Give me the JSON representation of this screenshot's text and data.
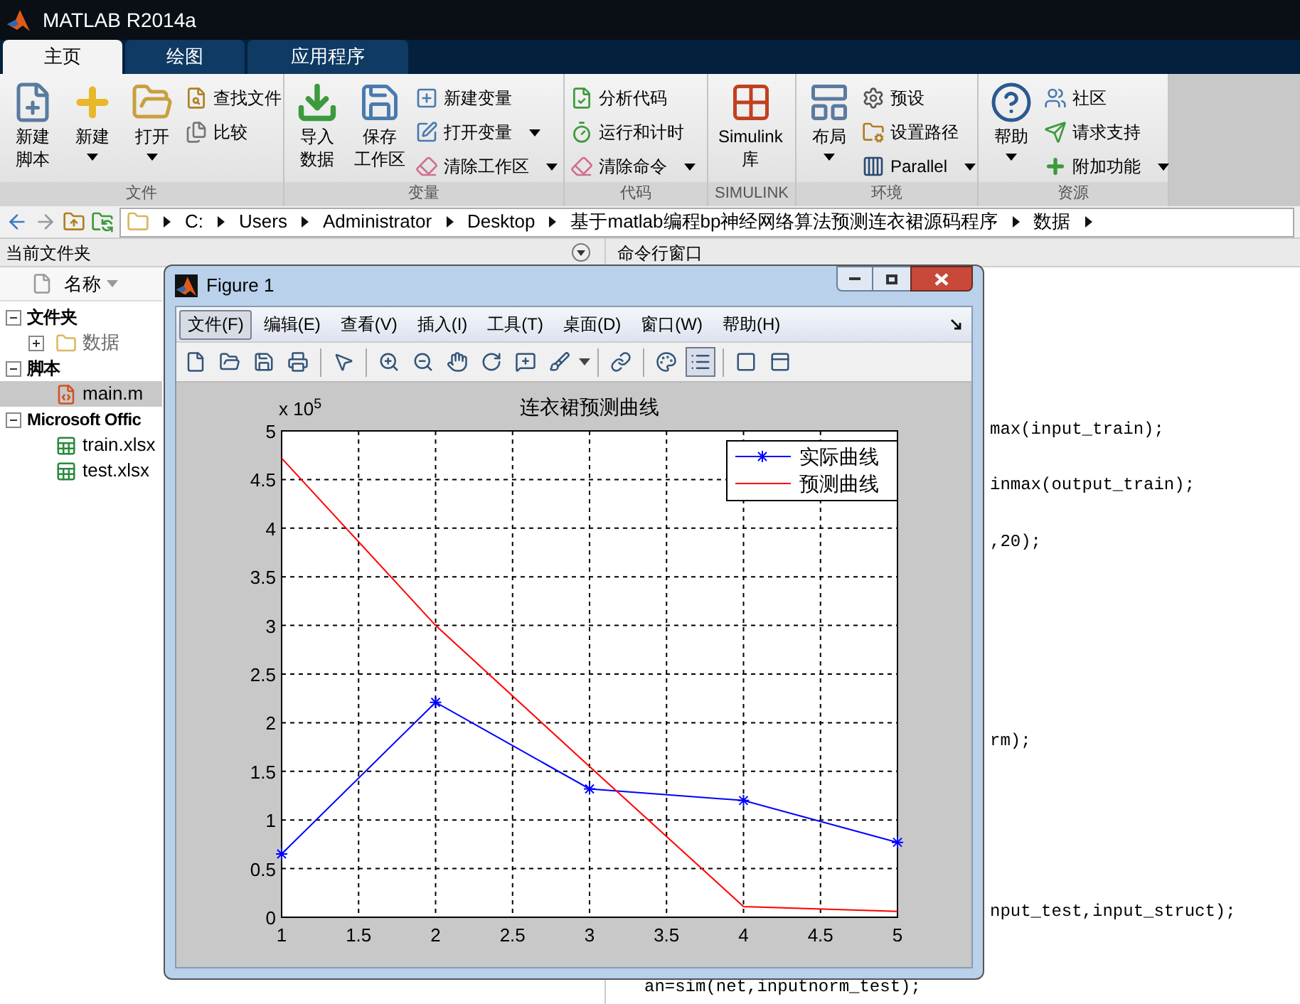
{
  "window": {
    "title": "MATLAB R2014a"
  },
  "tabs": [
    {
      "label": "主页",
      "selected": true
    },
    {
      "label": "绘图",
      "selected": false
    },
    {
      "label": "应用程序",
      "selected": false
    }
  ],
  "ribbon": {
    "groups": [
      {
        "label": "文件",
        "big": [
          {
            "lines": [
              "新建",
              "脚本"
            ],
            "has_menu": false
          },
          {
            "lines": [
              "新建"
            ],
            "has_menu": true
          },
          {
            "lines": [
              "打开"
            ],
            "has_menu": true
          }
        ],
        "small": [
          {
            "label": "查找文件",
            "has_menu": false
          },
          {
            "label": "比较",
            "has_menu": false
          }
        ]
      },
      {
        "label": "变量",
        "big": [
          {
            "lines": [
              "导入",
              "数据"
            ],
            "has_menu": false
          },
          {
            "lines": [
              "保存",
              "工作区"
            ],
            "has_menu": false
          }
        ],
        "small": [
          {
            "label": "新建变量",
            "has_menu": false
          },
          {
            "label": "打开变量",
            "has_menu": true
          },
          {
            "label": "清除工作区",
            "has_menu": true
          }
        ]
      },
      {
        "label": "代码",
        "small": [
          {
            "label": "分析代码",
            "has_menu": false
          },
          {
            "label": "运行和计时",
            "has_menu": false
          },
          {
            "label": "清除命令",
            "has_menu": true
          }
        ]
      },
      {
        "label": "SIMULINK",
        "big": [
          {
            "lines": [
              "Simulink",
              "库"
            ],
            "has_menu": false
          }
        ]
      },
      {
        "label": "环境",
        "big": [
          {
            "lines": [
              "布局"
            ],
            "has_menu": true
          }
        ],
        "small": [
          {
            "label": "预设",
            "has_menu": false
          },
          {
            "label": "设置路径",
            "has_menu": false
          },
          {
            "label": "Parallel",
            "has_menu": true
          }
        ]
      },
      {
        "label": "资源",
        "big": [
          {
            "lines": [
              "帮助"
            ],
            "has_menu": true
          }
        ],
        "small": [
          {
            "label": "社区",
            "has_menu": false
          },
          {
            "label": "请求支持",
            "has_menu": false
          },
          {
            "label": "附加功能",
            "has_menu": true
          }
        ]
      }
    ]
  },
  "address_bar": {
    "crumbs": [
      "C:",
      "Users",
      "Administrator",
      "Desktop",
      "基于matlab编程bp神经网络算法预测连衣裙源码程序",
      "数据"
    ]
  },
  "file_panel": {
    "title": "当前文件夹",
    "column": "名称",
    "tree": [
      {
        "label": "文件夹",
        "expanded": true,
        "children": [
          {
            "label": "数据",
            "kind": "folder",
            "expanded": false,
            "selected": false
          }
        ]
      },
      {
        "label": "脚本",
        "expanded": true,
        "children": [
          {
            "label": "main.m",
            "kind": "mfile",
            "selected": true
          }
        ]
      },
      {
        "label": "Microsoft Offic",
        "expanded": true,
        "children": [
          {
            "label": "train.xlsx",
            "kind": "excel",
            "selected": false
          },
          {
            "label": "test.xlsx",
            "kind": "excel",
            "selected": false
          }
        ]
      }
    ]
  },
  "command_window": {
    "title": "命令行窗口",
    "lines": [
      "max(input_train);",
      "inmax(output_train);",
      ",20);",
      "rm);",
      "nput_test,input_struct);",
      "an=sim(net,inputnorm_test);"
    ]
  },
  "figure": {
    "title": "Figure 1",
    "menu": [
      {
        "label": "文件(F)",
        "selected": true
      },
      {
        "label": "编辑(E)",
        "selected": false
      },
      {
        "label": "查看(V)",
        "selected": false
      },
      {
        "label": "插入(I)",
        "selected": false
      },
      {
        "label": "工具(T)",
        "selected": false
      },
      {
        "label": "桌面(D)",
        "selected": false
      },
      {
        "label": "窗口(W)",
        "selected": false
      },
      {
        "label": "帮助(H)",
        "selected": false
      }
    ],
    "toolbar": [
      {
        "kind": "new",
        "selected": false
      },
      {
        "kind": "open",
        "selected": false
      },
      {
        "kind": "save",
        "selected": false
      },
      {
        "kind": "print",
        "selected": false
      },
      {
        "kind": "pointer",
        "selected": false
      },
      {
        "kind": "zoom-in",
        "selected": false
      },
      {
        "kind": "zoom-out",
        "selected": false
      },
      {
        "kind": "pan",
        "selected": false
      },
      {
        "kind": "rotate",
        "selected": false
      },
      {
        "kind": "data-cursor",
        "selected": false
      },
      {
        "kind": "brush",
        "selected": false
      },
      {
        "kind": "link",
        "selected": false
      },
      {
        "kind": "colorbar",
        "selected": false
      },
      {
        "kind": "legend",
        "selected": true
      },
      {
        "kind": "hide-tools",
        "selected": false
      },
      {
        "kind": "dock",
        "selected": false
      }
    ],
    "axis_multiplier": "x 10$^{5}$",
    "chart_data": {
      "type": "line",
      "title": "连衣裙预测曲线",
      "grid": true,
      "legend": true,
      "x": [
        1,
        2,
        3,
        4,
        5
      ],
      "xlim": [
        1,
        5
      ],
      "ylim": [
        0,
        5
      ],
      "xticks": [
        1,
        1.5,
        2,
        2.5,
        3,
        3.5,
        4,
        4.5,
        5
      ],
      "yticks": [
        0,
        0.5,
        1,
        1.5,
        2,
        2.5,
        3,
        3.5,
        4,
        4.5,
        5
      ],
      "series": [
        {
          "name": "实际曲线",
          "color": "#0000ff",
          "marker": "cross",
          "values": [
            0.65,
            2.21,
            1.32,
            1.2,
            0.77
          ]
        },
        {
          "name": "预测曲线",
          "color": "#ff0000",
          "marker": "none",
          "values": [
            4.72,
            3.0,
            1.55,
            0.11,
            0.06
          ]
        }
      ]
    }
  }
}
